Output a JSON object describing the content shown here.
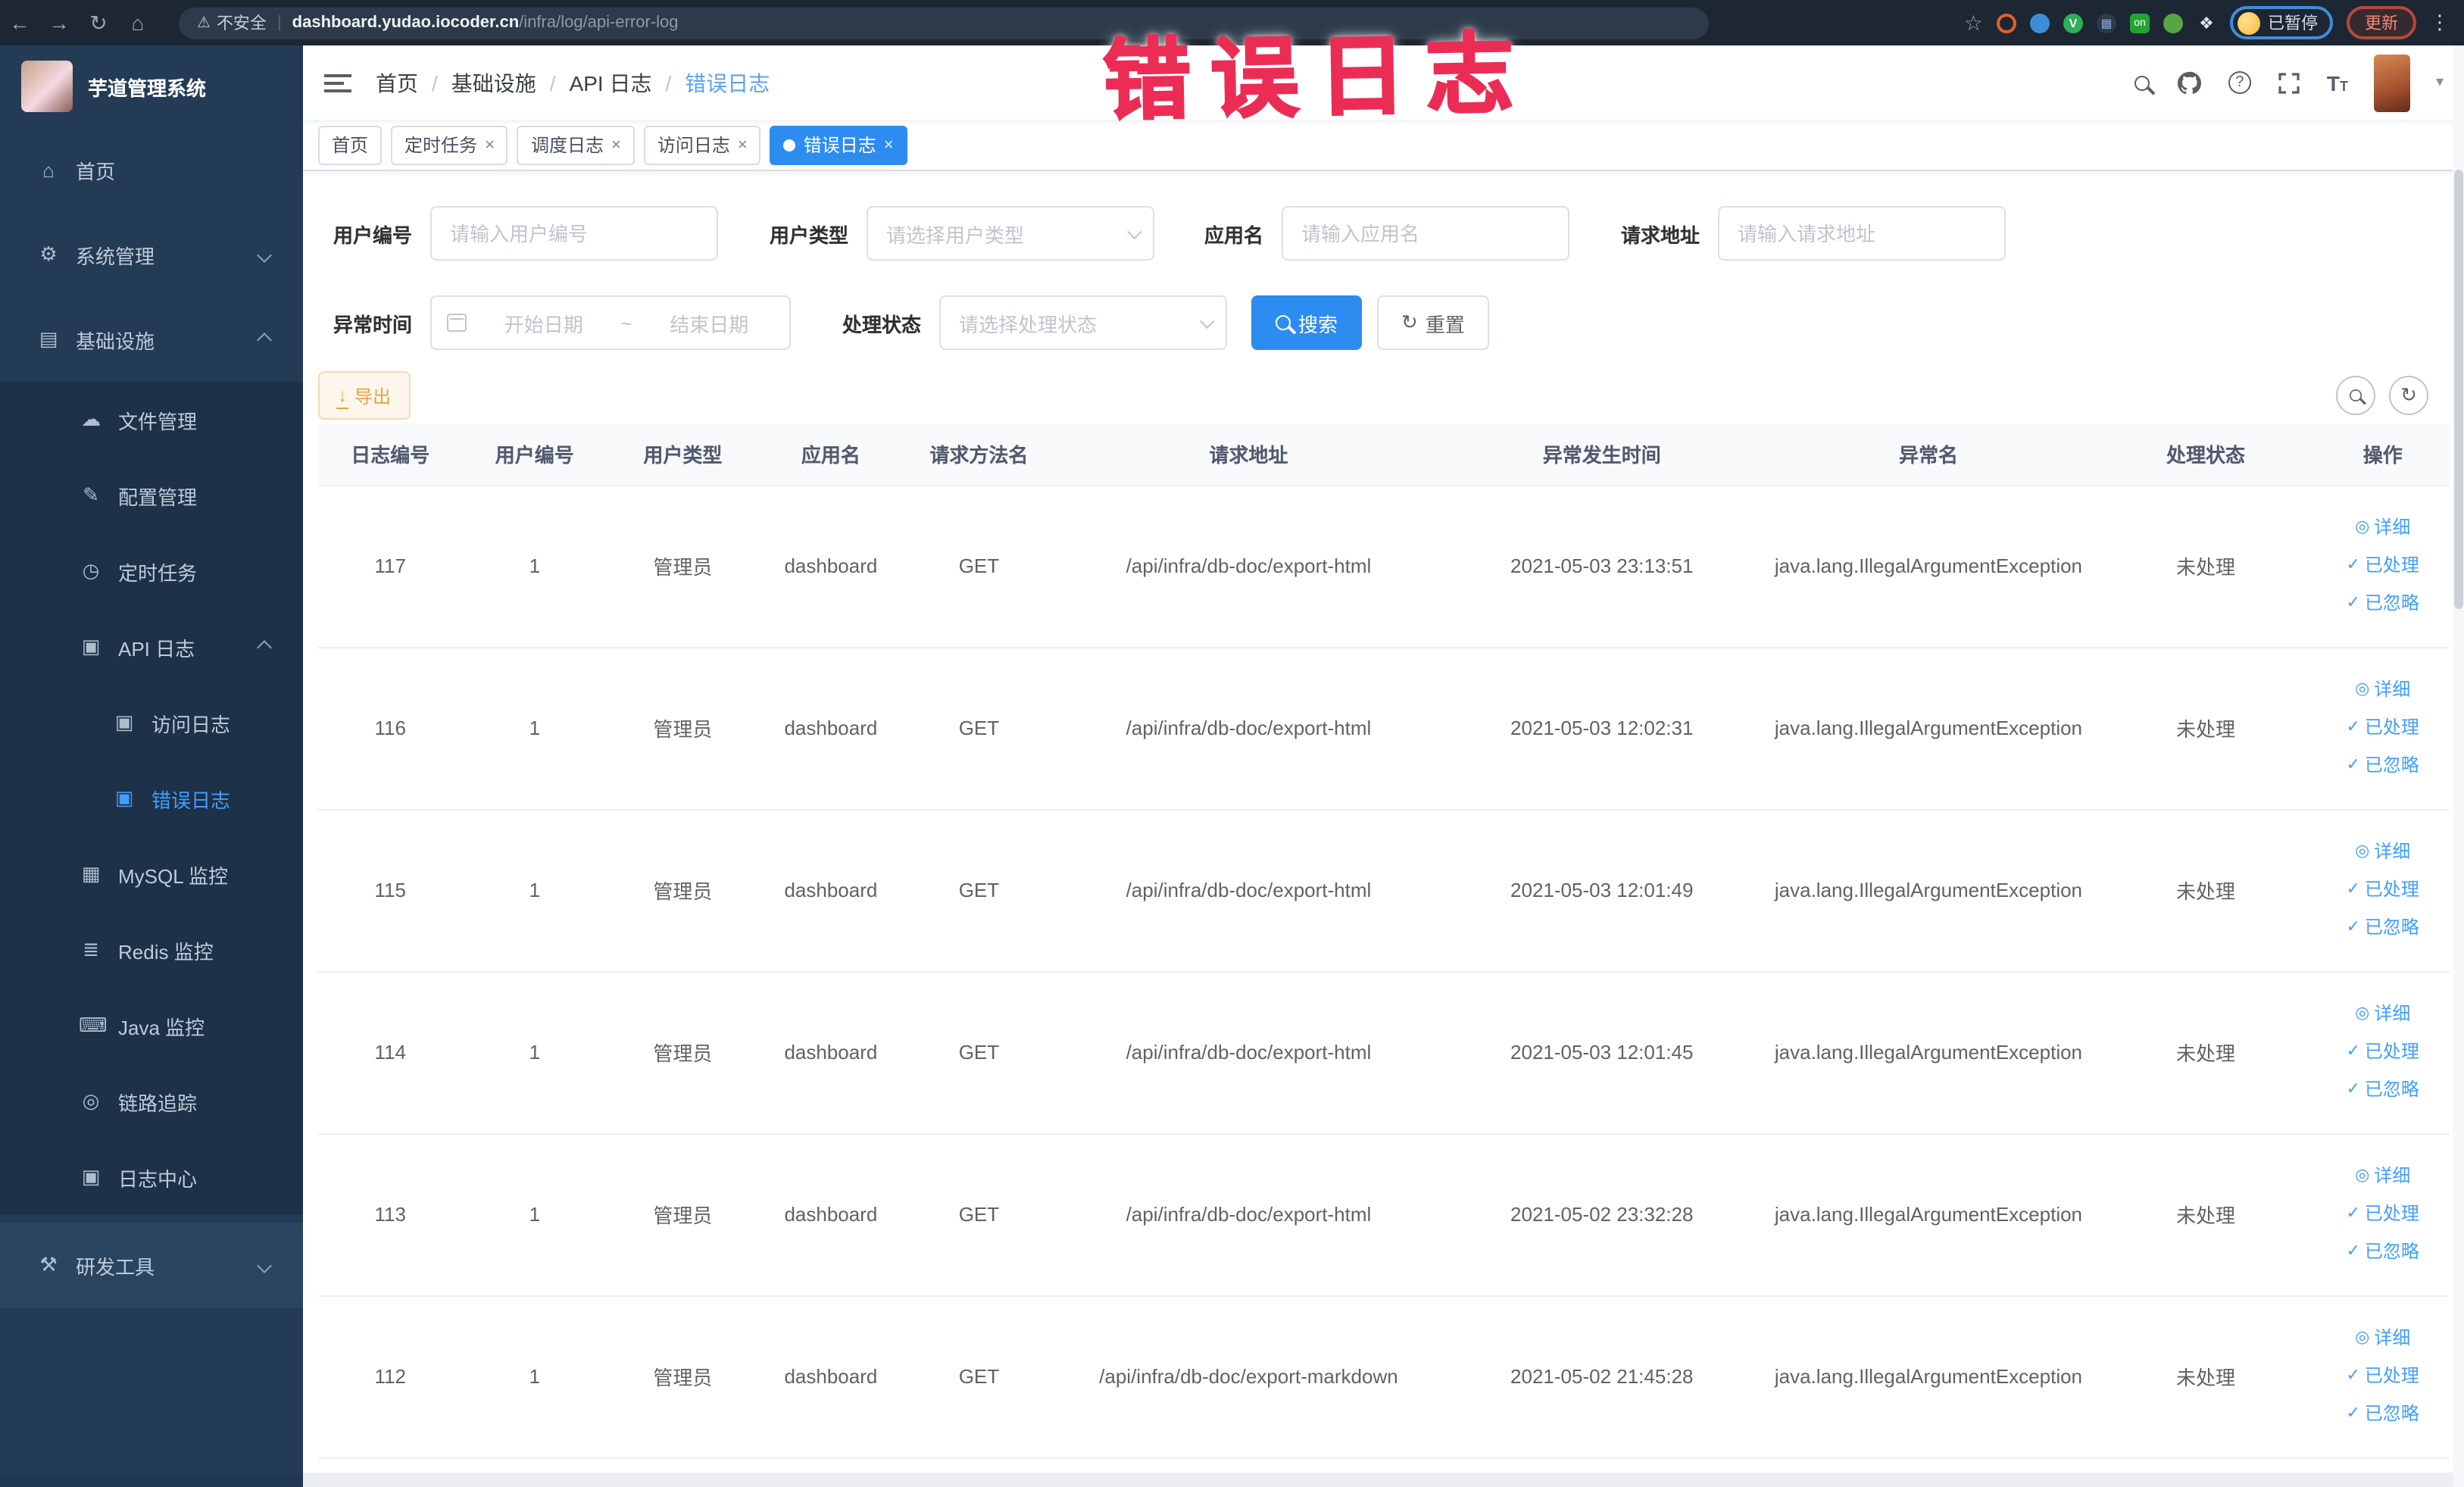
{
  "browser": {
    "security_label": "不安全",
    "url_domain": "dashboard.yudao.iocoder.cn",
    "url_path": "/infra/log/api-error-log",
    "profile_chip": "已暂停",
    "update_button": "更新"
  },
  "icons": {
    "back": "←",
    "forward": "→",
    "reload": "↻",
    "home": "⌂",
    "warn": "⚠",
    "pipe": "|",
    "star": "☆",
    "kebab": "⋮",
    "caret": "▾",
    "menu_home": "⌂",
    "menu_system": "⚙",
    "menu_infra": "▤",
    "menu_file": "☁",
    "menu_config": "✎",
    "menu_job": "◷",
    "menu_apilog": "▣",
    "menu_doc": "▣",
    "menu_mysql": "▦",
    "menu_redis": "≣",
    "menu_java": "⌨",
    "menu_trace": "◎",
    "menu_logcenter": "▣",
    "menu_dev": "⚒",
    "eye": "◎",
    "check": "✓",
    "download": "↓",
    "refresh": "↻",
    "range_sep": "~",
    "close": "×",
    "question": "?",
    "grid_ext": "▦",
    "v_ext": "V",
    "on_ext": "on",
    "puzzle_ext": "❖"
  },
  "sidebar": {
    "title": "芋道管理系统",
    "items": [
      {
        "label": "首页"
      },
      {
        "label": "系统管理"
      },
      {
        "label": "基础设施"
      },
      {
        "label": "文件管理"
      },
      {
        "label": "配置管理"
      },
      {
        "label": "定时任务"
      },
      {
        "label": "API 日志"
      },
      {
        "label": "访问日志"
      },
      {
        "label": "错误日志"
      },
      {
        "label": "MySQL 监控"
      },
      {
        "label": "Redis 监控"
      },
      {
        "label": "Java 监控"
      },
      {
        "label": "链路追踪"
      },
      {
        "label": "日志中心"
      },
      {
        "label": "研发工具"
      }
    ]
  },
  "navbar": {
    "breadcrumb": [
      "首页",
      "基础设施",
      "API 日志",
      "错误日志"
    ],
    "separator": "/"
  },
  "tags": [
    {
      "label": "首页"
    },
    {
      "label": "定时任务"
    },
    {
      "label": "调度日志"
    },
    {
      "label": "访问日志"
    },
    {
      "label": "错误日志"
    }
  ],
  "annotation": {
    "text": "错误日志",
    "color": "#eb2d55"
  },
  "filters": {
    "user_id": {
      "label": "用户编号",
      "placeholder": "请输入用户编号"
    },
    "user_type": {
      "label": "用户类型",
      "placeholder": "请选择用户类型"
    },
    "app_name": {
      "label": "应用名",
      "placeholder": "请输入应用名"
    },
    "request_url": {
      "label": "请求地址",
      "placeholder": "请输入请求地址"
    },
    "exception_time": {
      "label": "异常时间",
      "start_placeholder": "开始日期",
      "end_placeholder": "结束日期"
    },
    "process_status": {
      "label": "处理状态",
      "placeholder": "请选择处理状态"
    },
    "search_button": "搜索",
    "reset_button": "重置"
  },
  "toolbar": {
    "export_button": "导出"
  },
  "table": {
    "headers": [
      "日志编号",
      "用户编号",
      "用户类型",
      "应用名",
      "请求方法名",
      "请求地址",
      "异常发生时间",
      "异常名",
      "处理状态",
      "操作"
    ],
    "actions": [
      "详细",
      "已处理",
      "已忽略"
    ],
    "rows": [
      {
        "log_id": "117",
        "user_id": "1",
        "user_type": "管理员",
        "app_name": "dashboard",
        "method": "GET",
        "url": "/api/infra/db-doc/export-html",
        "time": "2021-05-03 23:13:51",
        "exception": "java.lang.IllegalArgumentException",
        "status": "未处理"
      },
      {
        "log_id": "116",
        "user_id": "1",
        "user_type": "管理员",
        "app_name": "dashboard",
        "method": "GET",
        "url": "/api/infra/db-doc/export-html",
        "time": "2021-05-03 12:02:31",
        "exception": "java.lang.IllegalArgumentException",
        "status": "未处理"
      },
      {
        "log_id": "115",
        "user_id": "1",
        "user_type": "管理员",
        "app_name": "dashboard",
        "method": "GET",
        "url": "/api/infra/db-doc/export-html",
        "time": "2021-05-03 12:01:49",
        "exception": "java.lang.IllegalArgumentException",
        "status": "未处理"
      },
      {
        "log_id": "114",
        "user_id": "1",
        "user_type": "管理员",
        "app_name": "dashboard",
        "method": "GET",
        "url": "/api/infra/db-doc/export-html",
        "time": "2021-05-03 12:01:45",
        "exception": "java.lang.IllegalArgumentException",
        "status": "未处理"
      },
      {
        "log_id": "113",
        "user_id": "1",
        "user_type": "管理员",
        "app_name": "dashboard",
        "method": "GET",
        "url": "/api/infra/db-doc/export-html",
        "time": "2021-05-02 23:32:28",
        "exception": "java.lang.IllegalArgumentException",
        "status": "未处理"
      },
      {
        "log_id": "112",
        "user_id": "1",
        "user_type": "管理员",
        "app_name": "dashboard",
        "method": "GET",
        "url": "/api/infra/db-doc/export-markdown",
        "time": "2021-05-02 21:45:28",
        "exception": "java.lang.IllegalArgumentException",
        "status": "未处理"
      }
    ]
  },
  "colors": {
    "primary": "#409eff",
    "sidebar_bg": "#243b55",
    "active_tag": "#2d8cf0"
  }
}
